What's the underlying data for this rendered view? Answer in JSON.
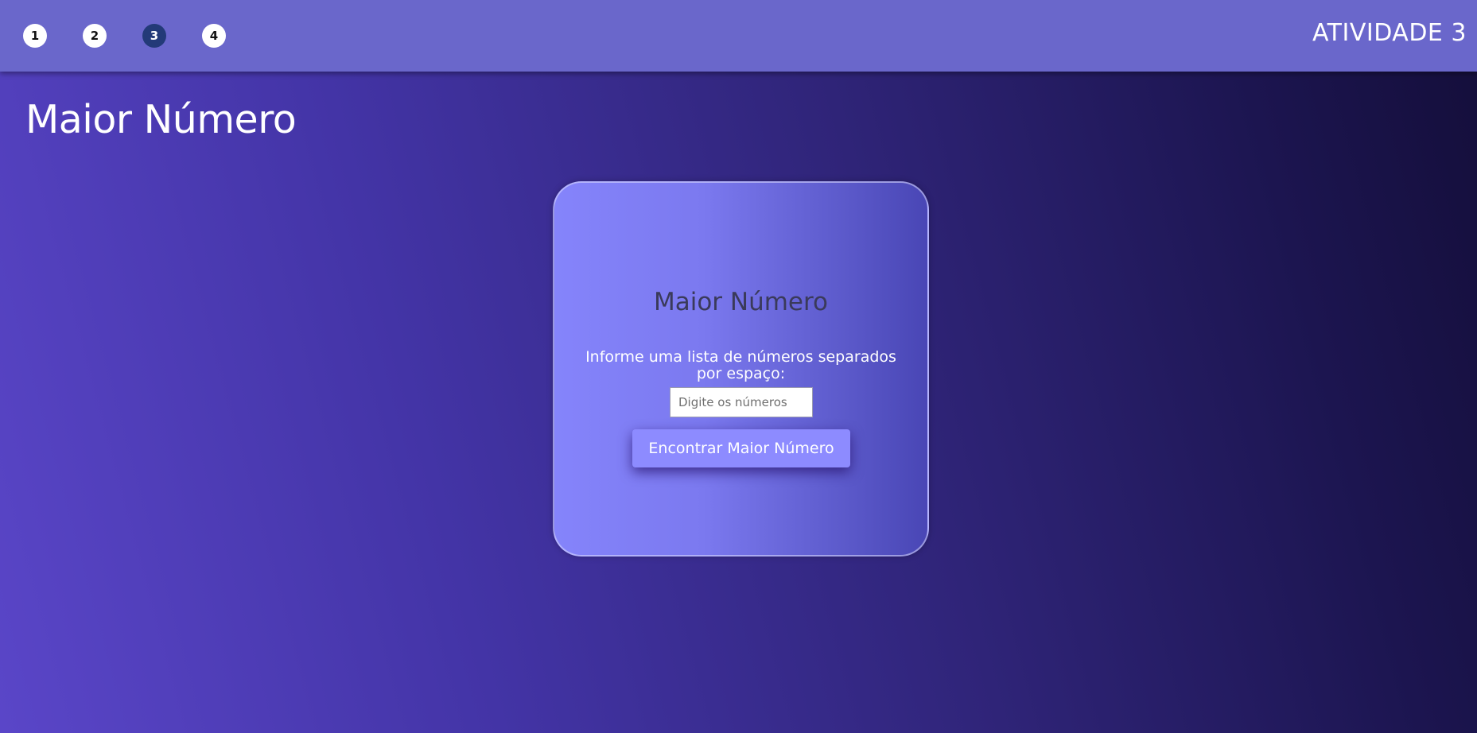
{
  "header": {
    "steps": [
      {
        "label": "1",
        "active": false
      },
      {
        "label": "2",
        "active": false
      },
      {
        "label": "3",
        "active": true
      },
      {
        "label": "4",
        "active": false
      }
    ],
    "activity_title": "ATIVIDADE 3"
  },
  "page": {
    "title": "Maior Número"
  },
  "card": {
    "title": "Maior Número",
    "instructions": "Informe uma lista de números separados por espaço:",
    "input": {
      "placeholder": "Digite os números",
      "value": ""
    },
    "button_label": "Encontrar Maior Número"
  },
  "colors": {
    "topbar": "#6a67cb",
    "active_step": "#233a78",
    "button": "#8d8bff",
    "card_gradient_start": "#8584fb",
    "card_gradient_end": "#4946b5",
    "background_start": "#5a46c8",
    "background_end": "#140e3a"
  }
}
